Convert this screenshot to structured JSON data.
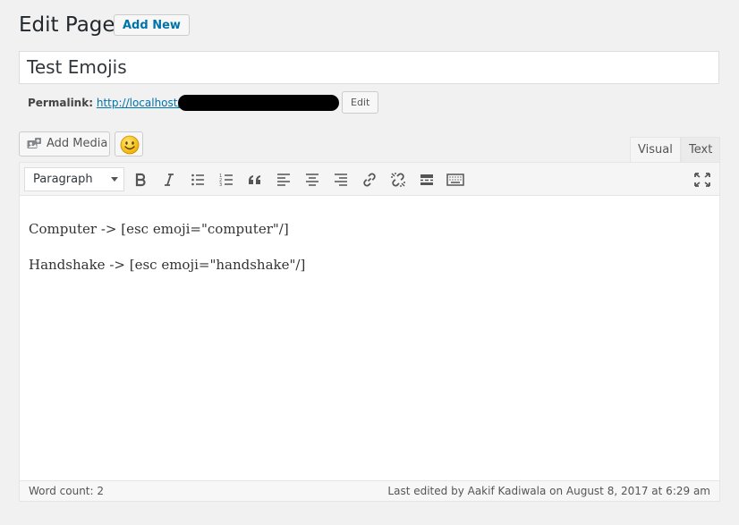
{
  "header": {
    "title": "Edit Page",
    "add_new_label": "Add New"
  },
  "post": {
    "title": "Test Emojis"
  },
  "permalink": {
    "label": "Permalink:",
    "url": "http://localhost/",
    "edit_label": "Edit"
  },
  "media": {
    "add_media_label": "Add Media",
    "emoji_icon": "smiley-emoji-icon"
  },
  "tabs": {
    "visual": "Visual",
    "text": "Text"
  },
  "toolbar": {
    "format_value": "Paragraph",
    "buttons": [
      "bold-icon",
      "italic-icon",
      "bulleted-list-icon",
      "numbered-list-icon",
      "blockquote-icon",
      "align-left-icon",
      "align-center-icon",
      "align-right-icon",
      "insert-link-icon",
      "remove-link-icon",
      "read-more-icon",
      "toolbar-toggle-icon",
      "fullscreen-icon"
    ]
  },
  "content": {
    "line1": "Computer ->  [esc emoji=\"computer\"/]",
    "line2": "Handshake ->  [esc emoji=\"handshake\"/]"
  },
  "status": {
    "word_count": "Word count: 2",
    "last_edited": "Last edited by Aakif Kadiwala on August 8, 2017 at 6:29 am"
  },
  "colors": {
    "link": "#0073aa",
    "background": "#f1f1f1",
    "text": "#23282d"
  }
}
